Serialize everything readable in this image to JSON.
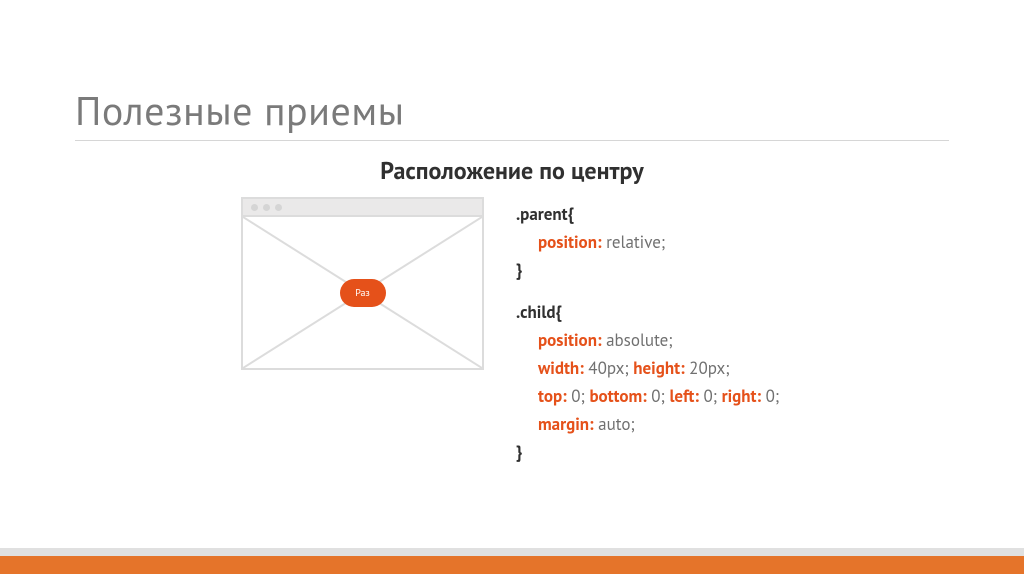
{
  "title": "Полезные приемы",
  "subtitle": "Расположение по центру",
  "pill_label": "Раз",
  "code": {
    "selector1": ".parent{",
    "p1_prop": "position:",
    "p1_val": " relative;",
    "close1": "}",
    "selector2": ".child{",
    "c1_prop": "position:",
    "c1_val": " absolute;",
    "c2_prop_a": "width:",
    "c2_val_a": " 40px; ",
    "c2_prop_b": "height:",
    "c2_val_b": " 20px;",
    "c3_prop_a": "top:",
    "c3_val_a": " 0; ",
    "c3_prop_b": "bottom:",
    "c3_val_b": " 0; ",
    "c3_prop_c": "left:",
    "c3_val_c": " 0; ",
    "c3_prop_d": "right:",
    "c3_val_d": " 0;",
    "c4_prop": "margin:",
    "c4_val": " auto;",
    "close2": "}"
  }
}
